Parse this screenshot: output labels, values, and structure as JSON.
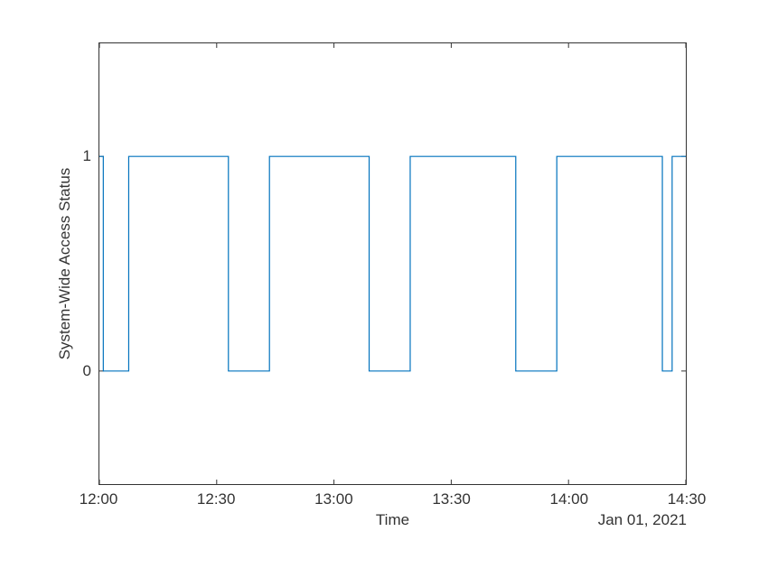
{
  "chart_data": {
    "type": "line",
    "title": "",
    "xlabel": "Time",
    "ylabel": "System-Wide Access Status",
    "date_label": "Jan 01, 2021",
    "x_ticks": [
      "12:00",
      "12:30",
      "13:00",
      "13:30",
      "14:00",
      "14:30"
    ],
    "y_ticks": [
      "0",
      "1"
    ],
    "xlim_minutes": [
      720,
      870
    ],
    "ylim": [
      -0.527,
      1.527
    ],
    "line_color": "#0072BD",
    "series": [
      {
        "name": "System-Wide Access Status",
        "points": [
          {
            "t": 720.0,
            "v": 1
          },
          {
            "t": 721.0,
            "v": 1
          },
          {
            "t": 721.0,
            "v": 0
          },
          {
            "t": 727.5,
            "v": 0
          },
          {
            "t": 727.5,
            "v": 1
          },
          {
            "t": 753.0,
            "v": 1
          },
          {
            "t": 753.0,
            "v": 0
          },
          {
            "t": 763.5,
            "v": 0
          },
          {
            "t": 763.5,
            "v": 1
          },
          {
            "t": 789.0,
            "v": 1
          },
          {
            "t": 789.0,
            "v": 0
          },
          {
            "t": 799.5,
            "v": 0
          },
          {
            "t": 799.5,
            "v": 1
          },
          {
            "t": 826.5,
            "v": 1
          },
          {
            "t": 826.5,
            "v": 0
          },
          {
            "t": 837.0,
            "v": 0
          },
          {
            "t": 837.0,
            "v": 1
          },
          {
            "t": 864.0,
            "v": 1
          },
          {
            "t": 864.0,
            "v": 0
          },
          {
            "t": 866.5,
            "v": 0
          },
          {
            "t": 866.5,
            "v": 1
          },
          {
            "t": 870.0,
            "v": 1
          }
        ]
      }
    ]
  }
}
